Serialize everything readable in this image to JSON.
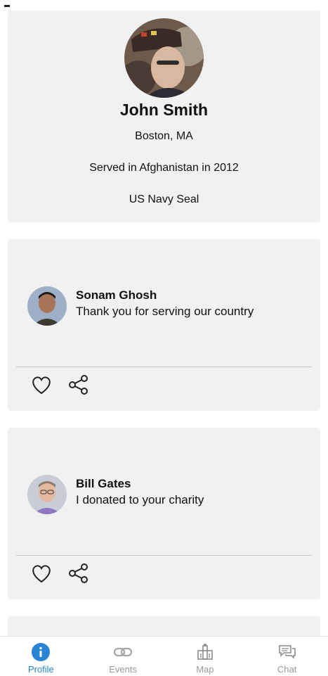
{
  "profile": {
    "name": "John Smith",
    "location": "Boston, MA",
    "service": "Served in Afghanistan in 2012",
    "role": "US Navy Seal"
  },
  "posts": [
    {
      "author": "Sonam Ghosh",
      "text": "Thank you for serving our country"
    },
    {
      "author": "Bill Gates",
      "text": "I donated to your charity"
    }
  ],
  "tabs": [
    {
      "label": "Profile",
      "icon": "info-icon",
      "active": true
    },
    {
      "label": "Events",
      "icon": "link-icon",
      "active": false
    },
    {
      "label": "Map",
      "icon": "map-icon",
      "active": false
    },
    {
      "label": "Chat",
      "icon": "chat-icon",
      "active": false
    }
  ],
  "colors": {
    "accent": "#2a84d6",
    "card": "#f1f1f1",
    "inactive": "#9a9a9a"
  }
}
